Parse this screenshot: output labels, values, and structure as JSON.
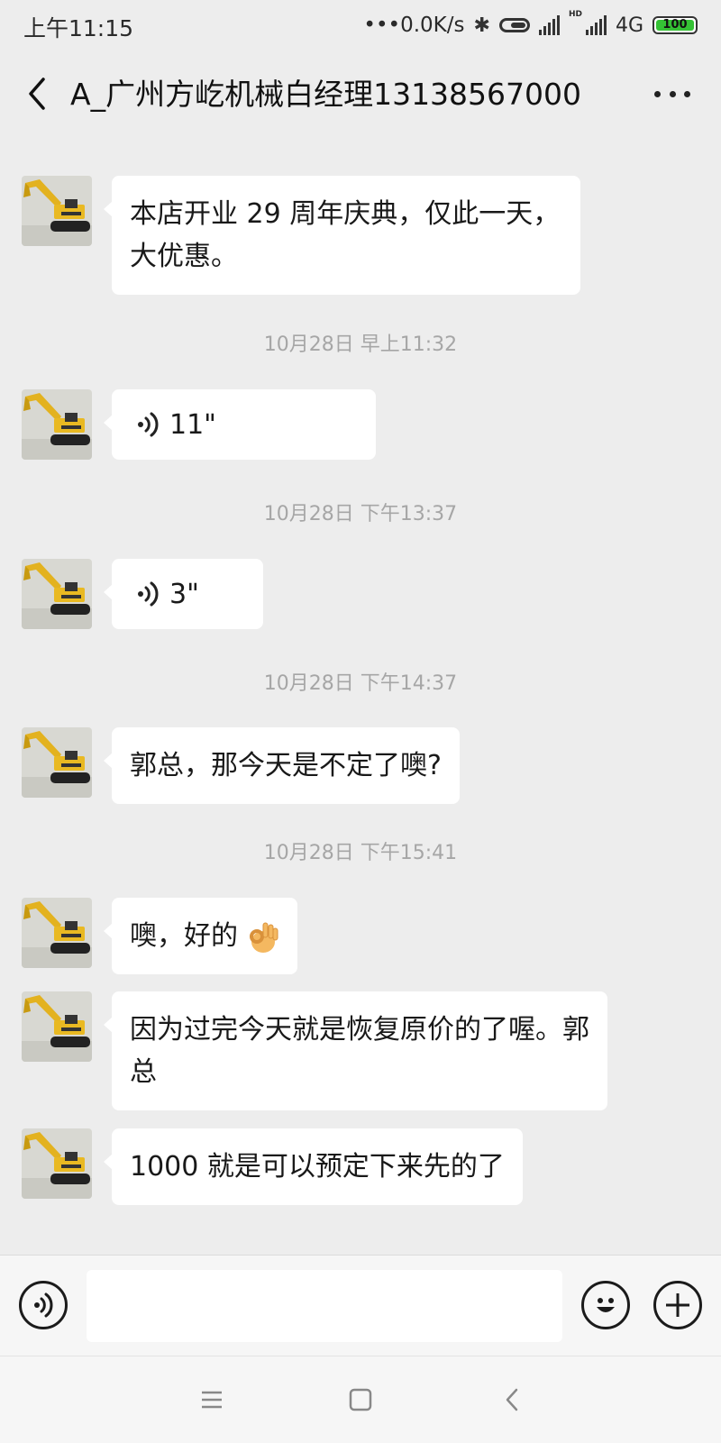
{
  "status_bar": {
    "time": "上午11:15",
    "net_speed": "•••0.0K/s",
    "hd_label": "HD",
    "network": "4G",
    "battery": "100",
    "battery_color": "#35c235"
  },
  "header": {
    "title": "A_广州方屹机械白经理13138567000",
    "back_icon": "back-chevron-icon",
    "more_icon": "more-dots-icon"
  },
  "chat": {
    "bubble_color": "#ffffff",
    "background": "#ededed",
    "timestamps": [
      "10月28日 早上11:32",
      "10月28日 下午13:37",
      "10月28日 下午14:37",
      "10月28日 下午15:41"
    ],
    "messages": [
      {
        "type": "text",
        "text": "本店开业 29 周年庆典，仅此一天，大优惠。"
      },
      {
        "type": "voice",
        "duration": "11\""
      },
      {
        "type": "voice",
        "duration": "3\""
      },
      {
        "type": "text",
        "text": "郭总，那今天是不定了噢?"
      },
      {
        "type": "text",
        "text": "噢，好的",
        "emoji": "ok-hand-emoji"
      },
      {
        "type": "text",
        "text": "因为过完今天就是恢复原价的了喔。郭总"
      },
      {
        "type": "text",
        "text": "1000 就是可以预定下来先的了"
      }
    ]
  },
  "input_bar": {
    "voice_icon": "voice-input-icon",
    "emoji_icon": "emoji-icon",
    "plus_icon": "plus-icon",
    "text_value": ""
  },
  "nav_bar": {
    "icons": [
      "menu-icon",
      "home-icon",
      "back-icon"
    ]
  }
}
